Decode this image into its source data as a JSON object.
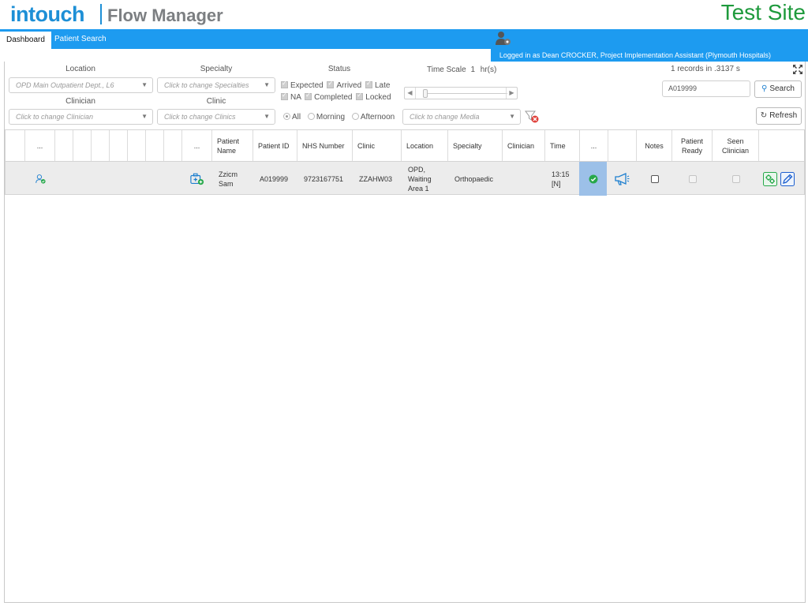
{
  "header": {
    "logo_primary": "intouch",
    "logo_secondary": "Flow Manager",
    "site_label": "Test Site"
  },
  "nav": {
    "tabs": [
      {
        "label": "Dashboard"
      },
      {
        "label": "Patient Search"
      }
    ],
    "user_text": "Logged in as Dean CROCKER, Project Implementation Assistant (Plymouth Hospitals)"
  },
  "filters": {
    "location_label": "Location",
    "location_value": "OPD Main Outpatient Dept., L6",
    "specialty_label": "Specialty",
    "specialty_placeholder": "Click to change Specialties",
    "clinician_label": "Clinician",
    "clinician_placeholder": "Click to change Clinician",
    "clinic_label": "Clinic",
    "clinic_placeholder": "Click to change Clinics",
    "status_label": "Status",
    "status_row1": [
      "Expected",
      "Arrived",
      "Late"
    ],
    "status_row2": [
      "NA",
      "Completed",
      "Locked"
    ],
    "radios": [
      "All",
      "Morning",
      "Afternoon"
    ],
    "media_placeholder": "Click to change Media",
    "timescale_label": "Time Scale",
    "timescale_value": "1",
    "timescale_unit": "hr(s)",
    "records_text": "1 records in .3137 s",
    "search_value": "A019999",
    "search_button": "Search",
    "refresh_button": "Refresh"
  },
  "table": {
    "headers": {
      "dots1": "...",
      "dots2": "...",
      "patient_name": "Patient Name",
      "patient_id": "Patient ID",
      "nhs_number": "NHS Number",
      "clinic": "Clinic",
      "location": "Location",
      "specialty": "Specialty",
      "clinician": "Clinician",
      "time": "Time",
      "dots3": "...",
      "notes": "Notes",
      "patient_ready": "Patient Ready",
      "seen_clinician": "Seen Clinician"
    },
    "rows": [
      {
        "patient_name": "Zzicm Sam",
        "patient_id": "A019999",
        "nhs_number": "9723167751",
        "clinic": "ZZAHW03",
        "location": "OPD, Waiting Area 1",
        "specialty": "Orthopaedic",
        "clinician": "",
        "time": "13:15 [N]"
      }
    ]
  },
  "colors": {
    "brand_blue": "#1d9bf0",
    "site_green": "#1e9a3c",
    "selected_cell": "#9cc0e8"
  }
}
